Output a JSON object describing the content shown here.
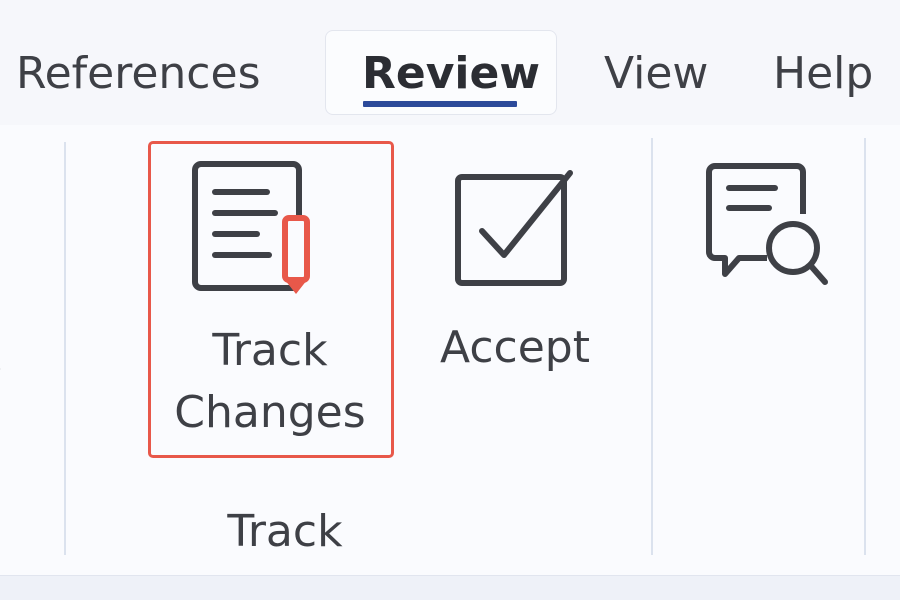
{
  "tabs": {
    "references": "References",
    "review": "Review",
    "view": "View",
    "help": "Help",
    "active": "Review"
  },
  "ribbon": {
    "track_changes": {
      "line1": "Track",
      "line2": "Changes",
      "icon": "track-changes-icon",
      "highlight_color": "#e8584a"
    },
    "accept": {
      "label": "Accept",
      "icon": "accept-checkbox-icon"
    },
    "search_comments": {
      "icon": "comment-search-icon"
    },
    "group_label": "Track"
  },
  "colors": {
    "active_tab_underline": "#2c4a9a",
    "highlight_border": "#e8584a",
    "pencil": "#e8584a"
  }
}
